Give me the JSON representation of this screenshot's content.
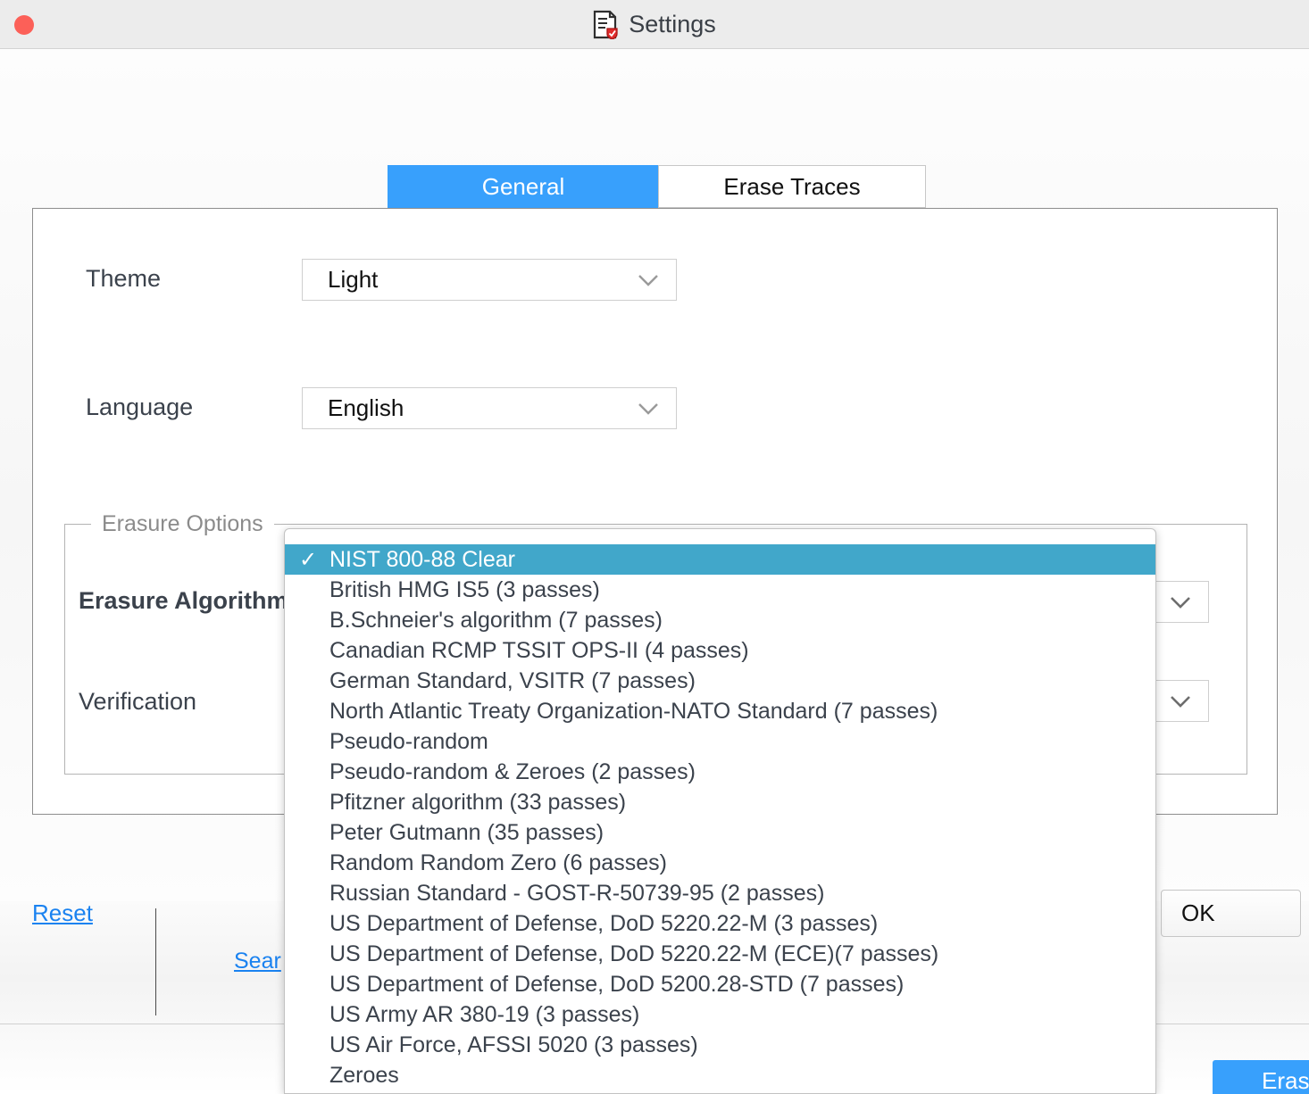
{
  "window": {
    "title": "Settings",
    "title_icon": "document-shield-icon",
    "close_button_icon": "close-traffic-light-icon"
  },
  "tabs": [
    {
      "label": "General",
      "selected": true
    },
    {
      "label": "Erase Traces",
      "selected": false
    }
  ],
  "general": {
    "theme": {
      "label": "Theme",
      "value": "Light",
      "chevron_icon": "chevron-down-icon"
    },
    "language": {
      "label": "Language",
      "value": "English",
      "chevron_icon": "chevron-down-icon"
    },
    "erasure_options": {
      "group_title": "Erasure Options",
      "erasure_algorithm": {
        "label": "Erasure Algorithm",
        "chevron_icon": "chevron-down-icon"
      },
      "verification": {
        "label": "Verification",
        "chevron_icon": "chevron-down-icon"
      }
    }
  },
  "dropdown": {
    "open": true,
    "selected_index": 0,
    "check_glyph": "✓",
    "items": [
      "NIST 800-88 Clear",
      "British HMG IS5 (3 passes)",
      "B.Schneier's algorithm (7 passes)",
      "Canadian RCMP TSSIT OPS-II (4 passes)",
      "German Standard, VSITR (7 passes)",
      "North Atlantic Treaty Organization-NATO Standard (7 passes)",
      "Pseudo-random",
      "Pseudo-random & Zeroes (2 passes)",
      "Pfitzner algorithm (33 passes)",
      "Peter Gutmann (35 passes)",
      "Random Random Zero (6 passes)",
      "Russian Standard - GOST-R-50739-95 (2 passes)",
      "US Department of Defense, DoD 5220.22-M (3 passes)",
      "US Department of Defense, DoD 5220.22-M (ECE)(7 passes)",
      "US Department of Defense, DoD 5200.28-STD (7 passes)",
      "US Army AR 380-19 (3 passes)",
      "US Air Force, AFSSI 5020 (3 passes)",
      "Zeroes"
    ]
  },
  "footer": {
    "reset_label": "Reset",
    "ok_label": "OK"
  },
  "background_window": {
    "search_link_label": "Sear",
    "erase_button_label": "Erase"
  },
  "colors": {
    "tab_active": "#38a0fc",
    "dropdown_highlight": "#41a7ca",
    "link": "#1a82f0",
    "titlebar": "#ececec",
    "close_dot": "#fc6058",
    "text": "#3b424c"
  }
}
